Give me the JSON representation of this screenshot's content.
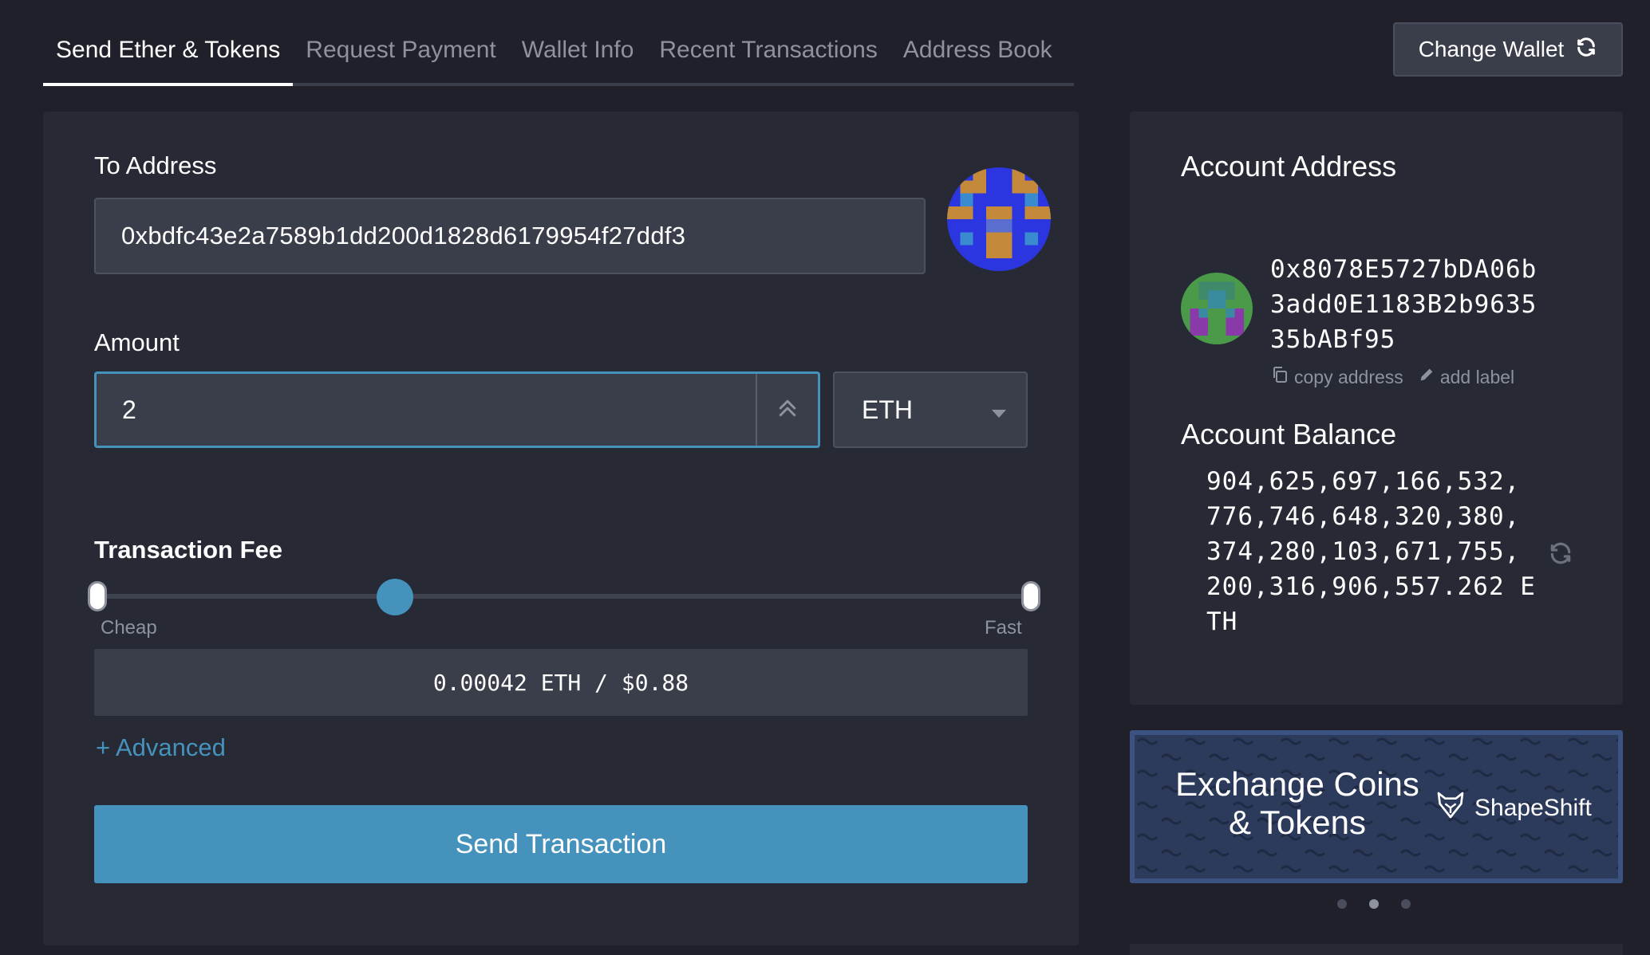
{
  "tabs": [
    {
      "label": "Send Ether & Tokens",
      "active": true
    },
    {
      "label": "Request Payment",
      "active": false
    },
    {
      "label": "Wallet Info",
      "active": false
    },
    {
      "label": "Recent Transactions",
      "active": false
    },
    {
      "label": "Address Book",
      "active": false
    }
  ],
  "header": {
    "change_wallet_label": "Change Wallet",
    "change_wallet_icon": "refresh-icon"
  },
  "send": {
    "to_address_label": "To Address",
    "to_address_value": "0xbdfc43e2a7589b1dd200d1828d6179954f27ddf3",
    "amount_label": "Amount",
    "amount_value": "2",
    "currency": "ETH",
    "fee_label": "Transaction Fee",
    "fee_slider_level": 0.32,
    "fee_min_label": "Cheap",
    "fee_max_label": "Fast",
    "fee_value": "0.00042 ETH / $0.88",
    "advanced_label": "+ Advanced",
    "send_button_label": "Send Transaction"
  },
  "account": {
    "address_title": "Account Address",
    "address_lines": [
      "0x8078E5727bDA06b",
      "3add0E1183B2b9635",
      "35bABf95"
    ],
    "copy_label": "copy address",
    "add_label": "add label",
    "balance_title": "Account Balance",
    "balance_lines": [
      "904,625,697,166,532,",
      "776,746,648,320,380,",
      "374,280,103,671,755,",
      "200,316,906,557.262 E",
      "TH"
    ]
  },
  "banner": {
    "line1": "Exchange Coins",
    "line2": "& Tokens",
    "brand": "ShapeShift",
    "carousel_active": 1
  },
  "colors": {
    "accent": "#4592bd",
    "background": "#1f2029",
    "card": "#272a35",
    "input": "#3a3d4a",
    "muted": "#8e929f",
    "banner": "#2c3b5c"
  }
}
